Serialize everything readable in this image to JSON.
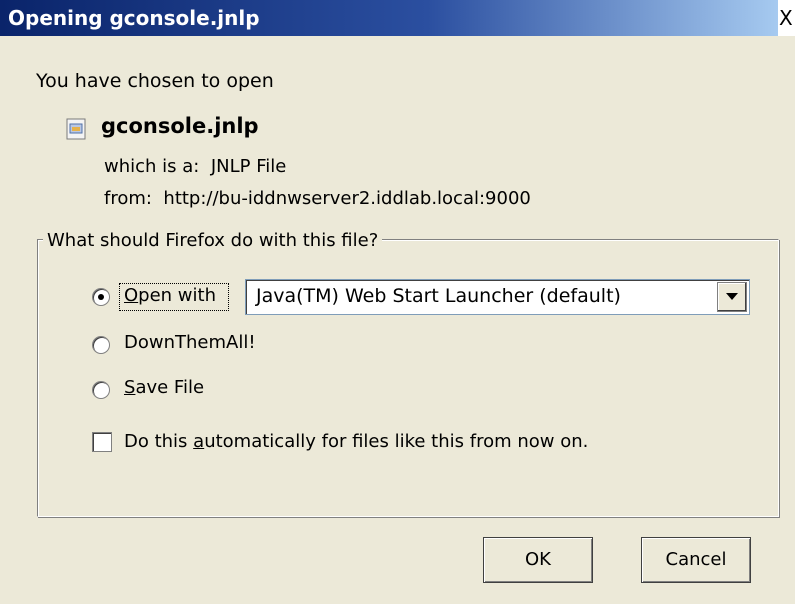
{
  "window": {
    "title": "Opening gconsole.jnlp",
    "close_glyph": "X"
  },
  "dialog": {
    "intro": "You have chosen to open",
    "file_icon": "jnlp-file-icon",
    "file_name": "gconsole.jnlp",
    "which_label": "which is a:",
    "which_value": "JNLP File",
    "from_label": "from:",
    "from_value": "http://bu-iddnwserver2.iddlab.local:9000"
  },
  "action_group": {
    "legend": "What should Firefox do with this file?",
    "options": [
      {
        "label": "Open with",
        "selected": true
      },
      {
        "label": "DownThemAll!",
        "selected": false
      },
      {
        "label": "Save File",
        "selected": false
      }
    ],
    "open_with_app": "Java(TM) Web Start Launcher (default)",
    "auto_checkbox_label_pre": "Do this ",
    "auto_checkbox_label_accel": "a",
    "auto_checkbox_label_post": "utomatically for files like this from now on.",
    "auto_checked": false
  },
  "buttons": {
    "ok": "OK",
    "cancel": "Cancel"
  }
}
